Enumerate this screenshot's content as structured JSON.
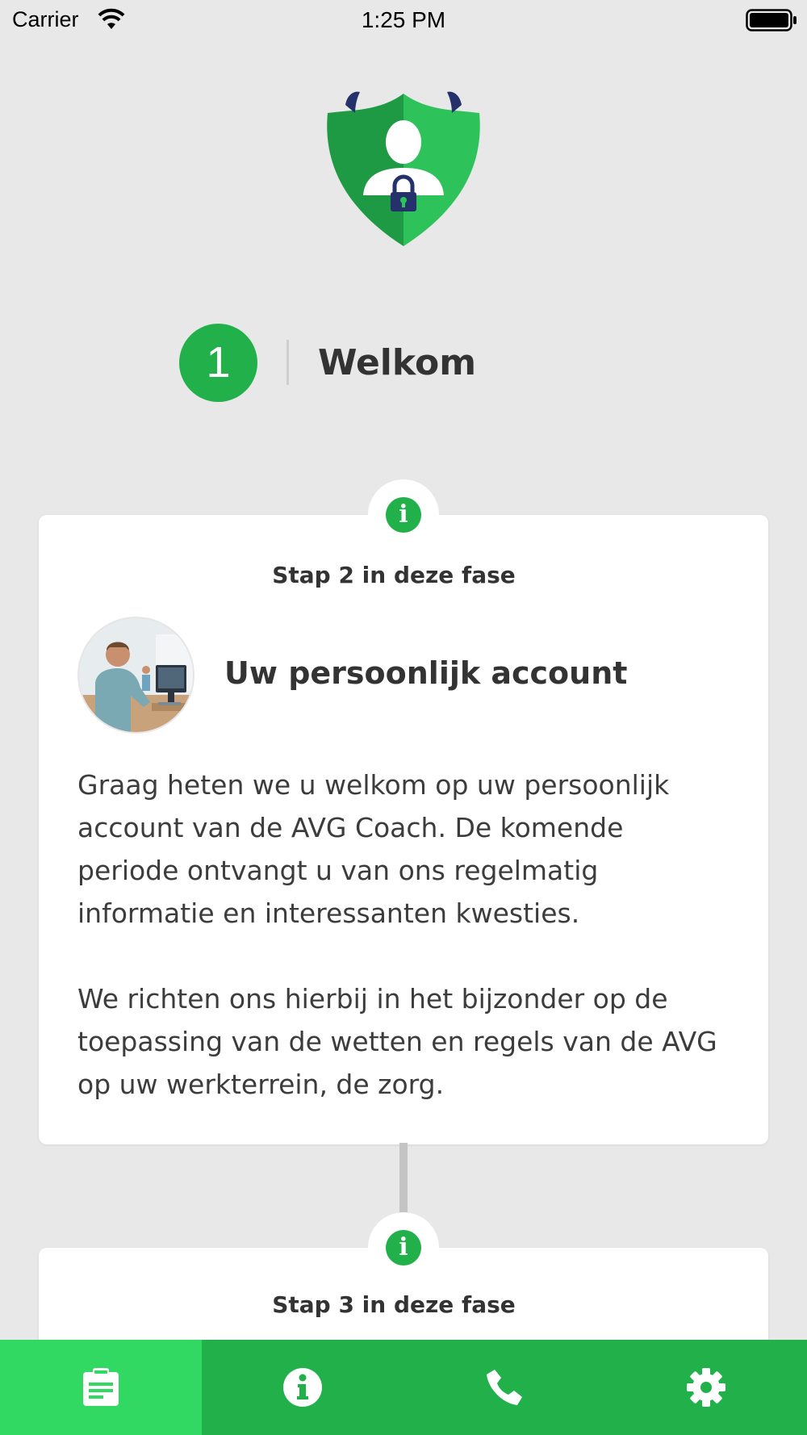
{
  "status_bar": {
    "carrier": "Carrier",
    "time": "1:25 PM",
    "icons": [
      "wifi-icon",
      "battery-icon"
    ]
  },
  "logo": {
    "icon": "shield-user-lock-logo"
  },
  "phase": {
    "number": "1",
    "title": "Welkom"
  },
  "cards": [
    {
      "badge_icon": "info-icon",
      "badge_glyph": "i",
      "step_label": "Stap 2 in deze fase",
      "title": "Uw persoonlijk account",
      "image": "photo-care-worker-at-computer",
      "paragraphs": [
        "Graag heten we u welkom op uw persoonlijk\naccount van de AVG Coach. De komende\nperiode ontvangt u van ons regelmatig\ninformatie en interessanten kwesties.",
        "We richten ons hierbij in het bijzonder op de\ntoepassing van de wetten en regels van de AVG\nop uw werkterrein, de zorg."
      ]
    },
    {
      "badge_icon": "info-icon",
      "badge_glyph": "i",
      "step_label": "Stap 3 in deze fase"
    }
  ],
  "tab_bar": {
    "items": [
      {
        "icon": "clipboard-icon",
        "active": true
      },
      {
        "icon": "info-icon",
        "active": false
      },
      {
        "icon": "phone-icon",
        "active": false
      },
      {
        "icon": "gear-icon",
        "active": false
      }
    ]
  },
  "colors": {
    "background": "#e8e8e8",
    "brand_green": "#22b04b",
    "active_tab_green": "#31d963",
    "text": "#333333"
  }
}
